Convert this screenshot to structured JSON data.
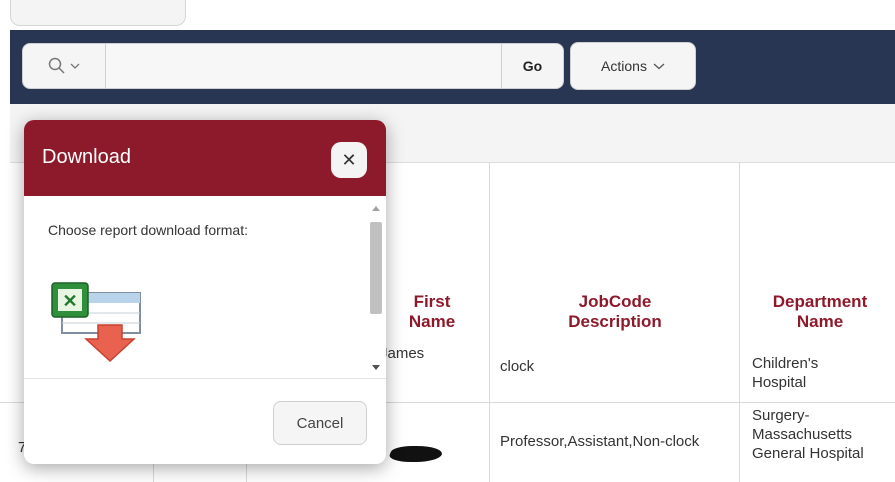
{
  "toolbar": {
    "go_label": "Go",
    "actions_label": "Actions",
    "search_value": ""
  },
  "table": {
    "headers": [
      "First Name",
      "JobCode Description",
      "Department Name"
    ],
    "rows": [
      {
        "first_name": "James",
        "jobcode": "clock",
        "department": "Children's Hospital"
      },
      {
        "row_prefix": "7",
        "first_name": "",
        "jobcode": "Professor,Assistant,Non-clock",
        "department": "Surgery-Massachusetts General Hospital"
      }
    ]
  },
  "dialog": {
    "title": "Download",
    "prompt": "Choose report download format:",
    "cancel_label": "Cancel"
  },
  "icons": [
    "search-icon",
    "chevron-down-icon",
    "close-icon",
    "excel-download-icon"
  ],
  "colors": {
    "toolbar_bg": "#283653",
    "accent": "#8d1a2b"
  }
}
